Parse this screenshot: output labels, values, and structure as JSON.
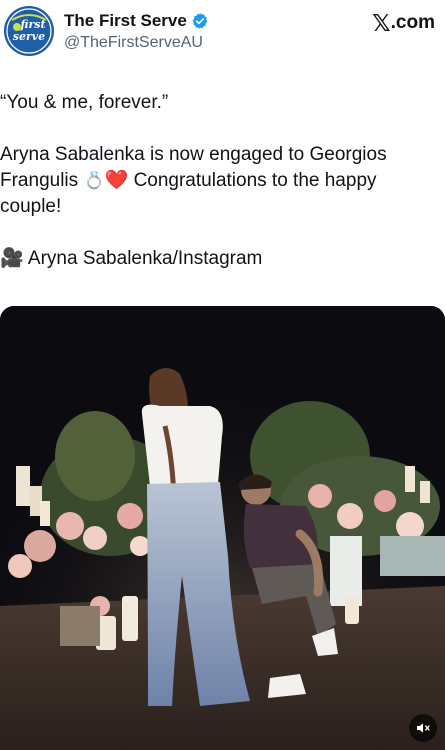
{
  "author": {
    "name": "The First Serve",
    "handle": "@TheFirstServeAU",
    "verified": true,
    "avatar_text_top": "first",
    "avatar_text_mid": "serve"
  },
  "platform": {
    "x_mark": "𝕏",
    "suffix": ".com"
  },
  "tweet": {
    "quote": "“You & me, forever.”",
    "body_main": "Aryna Sabalenka is now engaged to Georgios Frangulis",
    "emoji_ring": "💍",
    "emoji_heart": "❤️",
    "body_tail": "Congratulations to the happy couple!",
    "credit_icon": "🎥",
    "credit_text": "Aryna Sabalenka/Instagram"
  },
  "media": {
    "type": "video",
    "muted": true,
    "mute_icon": "volume-muted-icon"
  },
  "colors": {
    "text": "#0f1419",
    "secondary": "#536471",
    "verified_blue": "#1d9bf0",
    "avatar_blue": "#1f5fa8"
  }
}
